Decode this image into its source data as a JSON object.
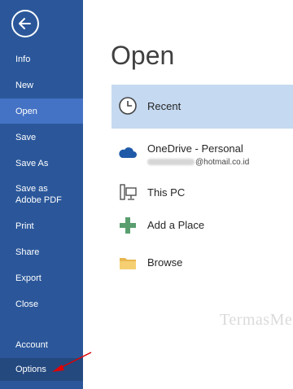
{
  "sidebar": {
    "back_icon": "back-arrow-icon",
    "items": [
      {
        "label": "Info"
      },
      {
        "label": "New"
      },
      {
        "label": "Open"
      },
      {
        "label": "Save"
      },
      {
        "label": "Save As"
      },
      {
        "label": "Save as Adobe PDF"
      },
      {
        "label": "Print"
      },
      {
        "label": "Share"
      },
      {
        "label": "Export"
      },
      {
        "label": "Close"
      },
      {
        "label": "Account"
      },
      {
        "label": "Options"
      }
    ],
    "active_item": "Open",
    "colors": {
      "background": "#2b579a",
      "active": "#4472c4"
    }
  },
  "main": {
    "title": "Open",
    "places": [
      {
        "label": "Recent",
        "icon": "clock-icon",
        "selected": true
      },
      {
        "label": "OneDrive - Personal",
        "sublabel": "@hotmail.co.id",
        "icon": "cloud-icon"
      },
      {
        "label": "This PC",
        "icon": "computer-icon"
      },
      {
        "label": "Add a Place",
        "icon": "plus-icon"
      },
      {
        "label": "Browse",
        "icon": "folder-icon"
      }
    ]
  },
  "watermark": "TermasMedia",
  "annotation": {
    "icon": "red-arrow-icon",
    "color": "#e00000"
  }
}
